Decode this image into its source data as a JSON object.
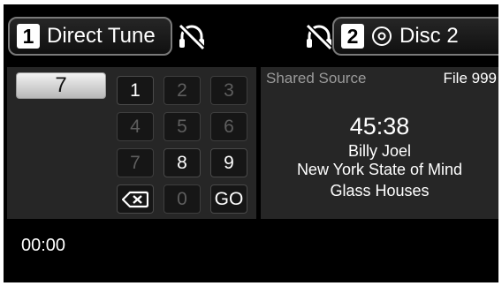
{
  "header": {
    "left_tab": {
      "number": "1",
      "label": "Direct Tune"
    },
    "right_tab": {
      "number": "2",
      "label": "Disc 2"
    },
    "icons": [
      "headphones-off-icon",
      "headphones-off-icon",
      "disc-icon"
    ]
  },
  "keypad": {
    "entry": "7",
    "keys": [
      {
        "label": "1",
        "enabled": true
      },
      {
        "label": "2",
        "enabled": false
      },
      {
        "label": "3",
        "enabled": false
      },
      {
        "label": "4",
        "enabled": false
      },
      {
        "label": "5",
        "enabled": false
      },
      {
        "label": "6",
        "enabled": false
      },
      {
        "label": "7",
        "enabled": false
      },
      {
        "label": "8",
        "enabled": true
      },
      {
        "label": "9",
        "enabled": true
      },
      {
        "label": "",
        "icon": "backspace-icon",
        "enabled": true
      },
      {
        "label": "0",
        "enabled": false
      },
      {
        "label": "GO",
        "enabled": true
      }
    ]
  },
  "now_playing": {
    "source": "Shared Source",
    "file": "File 999",
    "elapsed": "45:38",
    "artist": "Billy Joel",
    "song": "New York State of Mind",
    "album": "Glass Houses"
  },
  "footer": {
    "time": "00:00"
  }
}
